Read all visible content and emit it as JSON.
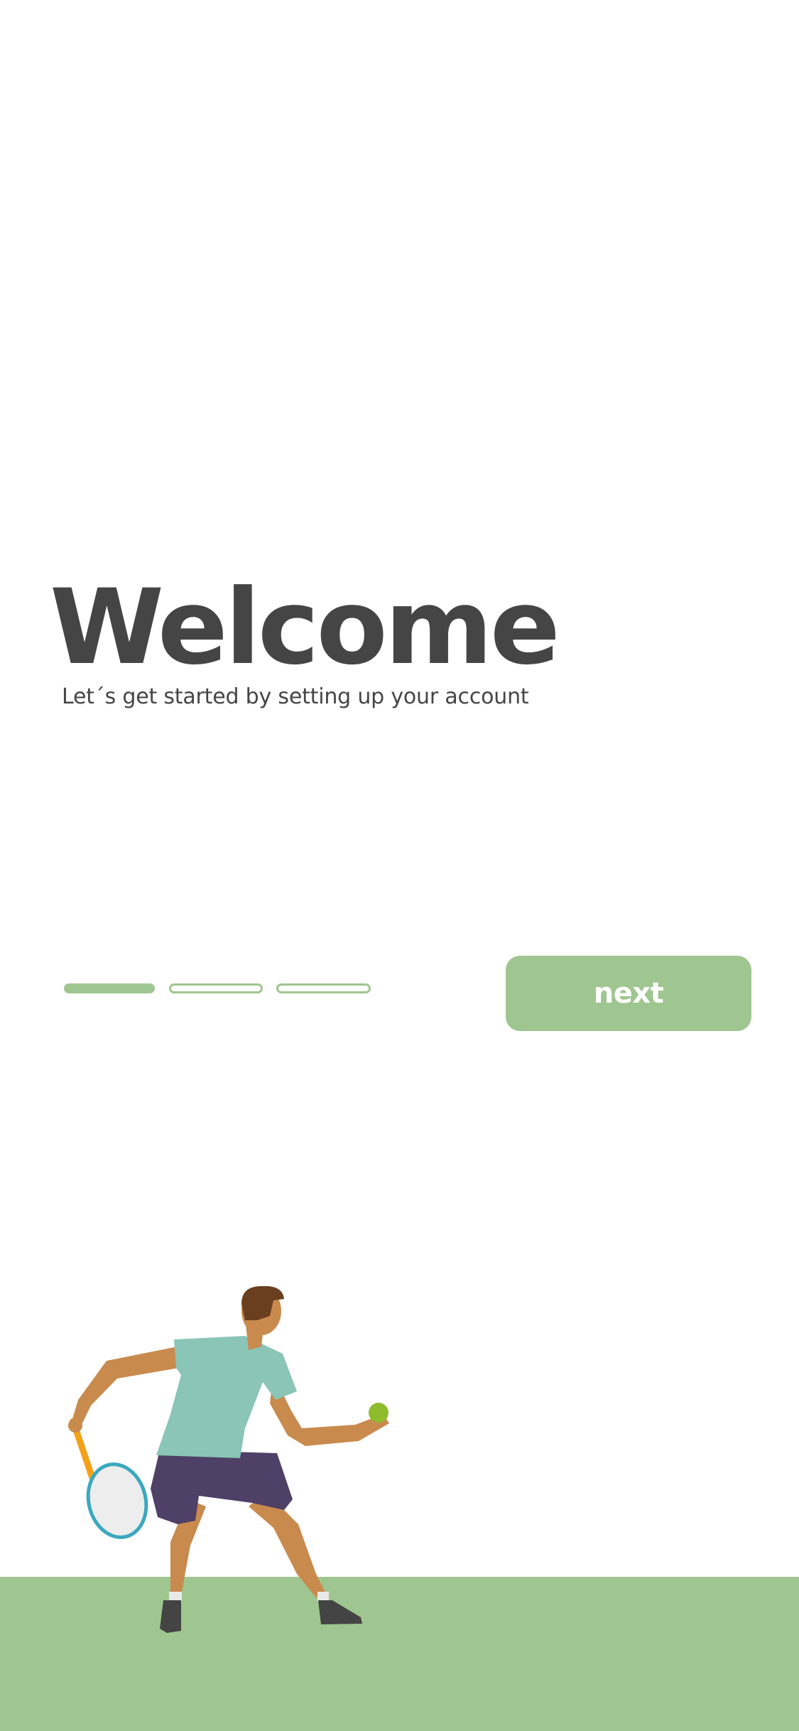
{
  "welcome": {
    "title": "Welcome",
    "subtitle": "Let´s get started by setting up your account"
  },
  "pager": {
    "total_steps": 3,
    "current_step": 1
  },
  "actions": {
    "next_label": "next"
  },
  "colors": {
    "accent": "#9fc690",
    "text": "#454545",
    "background": "#ffffff"
  },
  "illustration": {
    "icon": "tennis-player-illustration"
  }
}
